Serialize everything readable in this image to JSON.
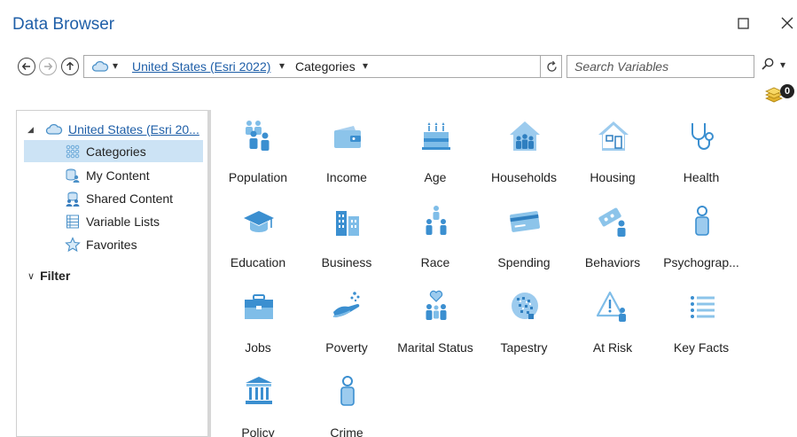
{
  "window": {
    "title": "Data Browser"
  },
  "nav": {
    "path_link": "United States (Esri 2022)",
    "path_category": "Categories",
    "search_placeholder": "Search Variables"
  },
  "badge": {
    "count": "0"
  },
  "tree": {
    "root": "United States (Esri 20...",
    "items": [
      "Categories",
      "My Content",
      "Shared Content",
      "Variable Lists",
      "Favorites"
    ],
    "filter": "Filter"
  },
  "categories": [
    {
      "label": "Population",
      "icon": "population-icon"
    },
    {
      "label": "Income",
      "icon": "wallet-icon"
    },
    {
      "label": "Age",
      "icon": "birthday-cake-icon"
    },
    {
      "label": "Households",
      "icon": "household-icon"
    },
    {
      "label": "Housing",
      "icon": "house-icon"
    },
    {
      "label": "Health",
      "icon": "stethoscope-icon"
    },
    {
      "label": "Education",
      "icon": "graduation-cap-icon"
    },
    {
      "label": "Business",
      "icon": "buildings-icon"
    },
    {
      "label": "Race",
      "icon": "people-group-icon"
    },
    {
      "label": "Spending",
      "icon": "credit-card-icon"
    },
    {
      "label": "Behaviors",
      "icon": "ticket-person-icon"
    },
    {
      "label": "Psychograp...",
      "icon": "person-icon"
    },
    {
      "label": "Jobs",
      "icon": "briefcase-icon"
    },
    {
      "label": "Poverty",
      "icon": "hand-coins-icon"
    },
    {
      "label": "Marital Status",
      "icon": "heart-family-icon"
    },
    {
      "label": "Tapestry",
      "icon": "tapestry-globe-icon"
    },
    {
      "label": "At Risk",
      "icon": "warning-person-icon"
    },
    {
      "label": "Key Facts",
      "icon": "list-icon"
    },
    {
      "label": "Policy",
      "icon": "government-building-icon"
    },
    {
      "label": "Crime",
      "icon": "person-silhouette-icon"
    }
  ],
  "colors": {
    "accent": "#1f5fa8",
    "icon_blue": "#5aa8dc",
    "icon_dark": "#2f7fc0",
    "selected": "#cce3f5"
  }
}
